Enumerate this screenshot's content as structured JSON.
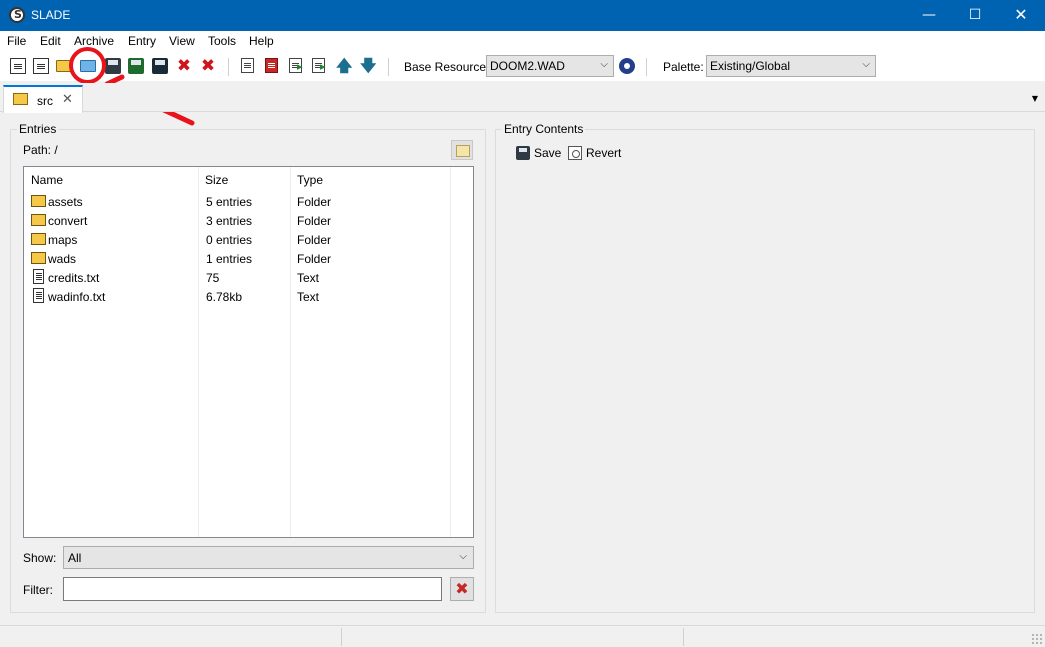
{
  "window": {
    "title": "SLADE",
    "minimize": "—",
    "maximize": "☐",
    "close": "✕"
  },
  "menu": [
    "File",
    "Edit",
    "Archive",
    "Entry",
    "View",
    "Tools",
    "Help"
  ],
  "toolbar": {
    "base_resource_label": "Base Resource:",
    "base_resource_value": "DOOM2.WAD",
    "palette_label": "Palette:",
    "palette_value": "Existing/Global",
    "up_arrow": "🡅",
    "down_arrow": "🡇",
    "close_glyph": "✖"
  },
  "tabs": [
    {
      "label": "src",
      "close": "✕"
    }
  ],
  "tab_menu_glyph": "▼",
  "entries_panel": {
    "title": "Entries",
    "path": "Path: /",
    "columns": [
      "Name",
      "Size",
      "Type"
    ],
    "rows": [
      {
        "icon": "folder-icon",
        "name": "assets",
        "size": "5 entries",
        "type": "Folder"
      },
      {
        "icon": "folder-icon",
        "name": "convert",
        "size": "3 entries",
        "type": "Folder"
      },
      {
        "icon": "folder-icon",
        "name": "maps",
        "size": "0 entries",
        "type": "Folder"
      },
      {
        "icon": "folder-icon",
        "name": "wads",
        "size": "1 entries",
        "type": "Folder"
      },
      {
        "icon": "text-file-icon",
        "name": "credits.txt",
        "size": "75",
        "type": "Text"
      },
      {
        "icon": "text-file-icon",
        "name": "wadinfo.txt",
        "size": "6.78kb",
        "type": "Text"
      }
    ],
    "show_label": "Show:",
    "show_value": "All",
    "filter_label": "Filter:",
    "filter_value": "",
    "filter_clear_glyph": "✖"
  },
  "entry_contents": {
    "title": "Entry Contents",
    "save_label": "Save",
    "revert_label": "Revert"
  },
  "colors": {
    "titlebar": "#0063b1",
    "annotation": "#e8141c",
    "tab_accent": "#0078d7"
  }
}
